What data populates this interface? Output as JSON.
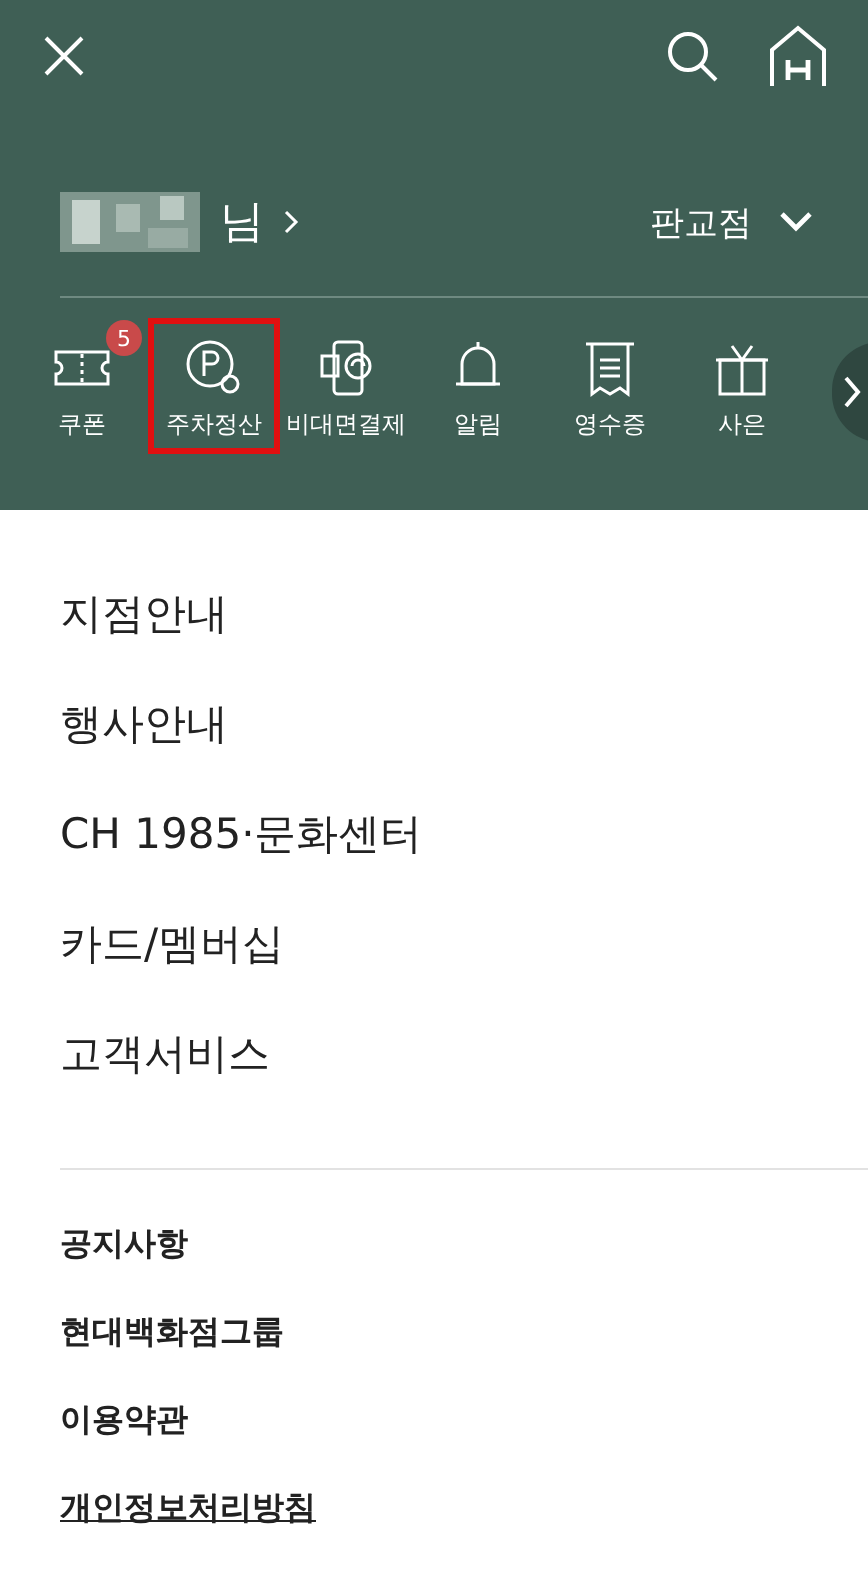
{
  "header": {
    "name_suffix": "님",
    "store": "판교점"
  },
  "quick_menu": [
    {
      "label": "쿠폰",
      "badge": "5",
      "highlighted": false
    },
    {
      "label": "주차정산",
      "highlighted": true
    },
    {
      "label": "비대면결제",
      "highlighted": false
    },
    {
      "label": "알림",
      "highlighted": false
    },
    {
      "label": "영수증",
      "highlighted": false
    },
    {
      "label": "사은",
      "highlighted": false
    }
  ],
  "menu": [
    "지점안내",
    "행사안내",
    "CH 1985·문화센터",
    "카드/멤버십",
    "고객서비스"
  ],
  "footer_links": [
    {
      "label": "공지사항",
      "underlined": false
    },
    {
      "label": "현대백화점그룹",
      "underlined": false
    },
    {
      "label": "이용약관",
      "underlined": false
    },
    {
      "label": "개인정보처리방침",
      "underlined": true
    }
  ]
}
